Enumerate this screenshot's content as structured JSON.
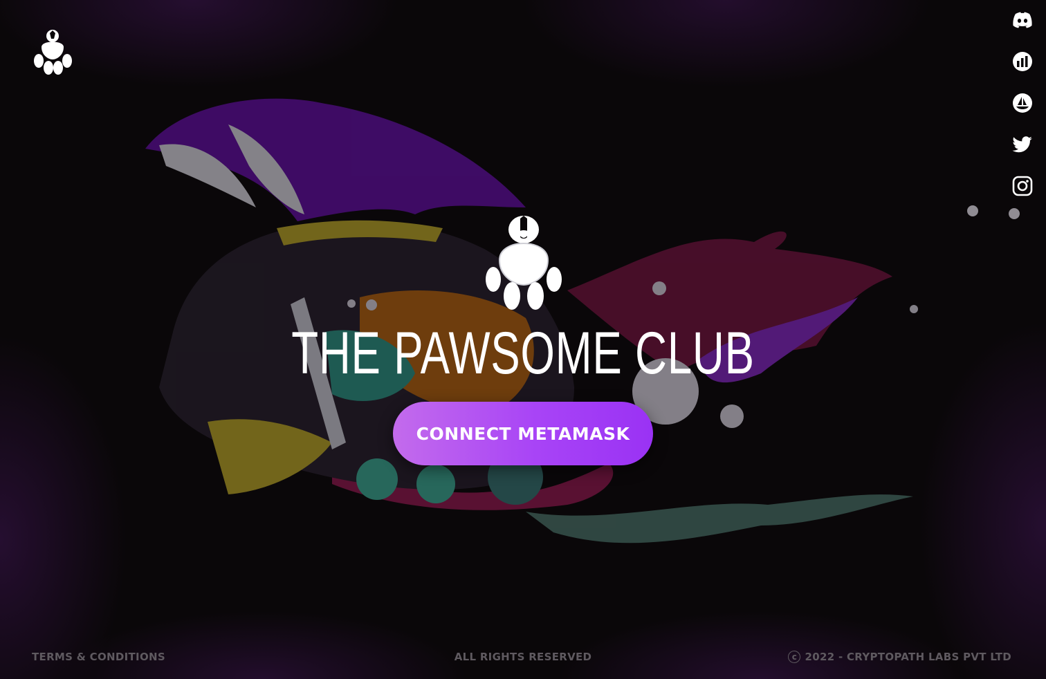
{
  "brand": {
    "logo_icon": "paw-dog-logo-icon"
  },
  "social": [
    {
      "name": "discord",
      "icon": "discord-icon"
    },
    {
      "name": "coinmarketcap",
      "icon": "chart-icon"
    },
    {
      "name": "opensea",
      "icon": "sailboat-icon"
    },
    {
      "name": "twitter",
      "icon": "twitter-icon"
    },
    {
      "name": "instagram",
      "icon": "instagram-icon"
    }
  ],
  "hero": {
    "title": "THE PAWSOME CLUB",
    "cta_label": "CONNECT METAMASK"
  },
  "footer": {
    "terms": "TERMS & CONDITIONS",
    "rights": "ALL RIGHTS RESERVED",
    "copyright": "2022 - CRYPTOPATH LABS PVT LTD"
  },
  "colors": {
    "background": "#0a0709",
    "accent_start": "#c36bec",
    "accent_end": "#9a32f4",
    "footer_text": "#5f5a60"
  }
}
